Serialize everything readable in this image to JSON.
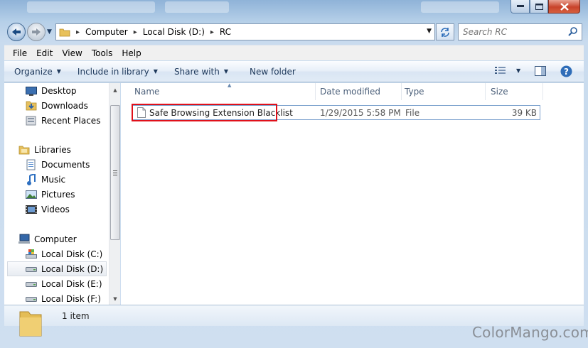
{
  "window": {
    "breadcrumbs": [
      "Computer",
      "Local Disk (D:)",
      "RC"
    ]
  },
  "search": {
    "placeholder": "Search RC"
  },
  "menu": [
    "File",
    "Edit",
    "View",
    "Tools",
    "Help"
  ],
  "commands": {
    "organize": "Organize",
    "include_in_library": "Include in library",
    "share_with": "Share with",
    "new_folder": "New folder"
  },
  "navpane": {
    "favorites": [
      {
        "label": "Desktop",
        "icon": "desktop-icon"
      },
      {
        "label": "Downloads",
        "icon": "downloads-folder-icon"
      },
      {
        "label": "Recent Places",
        "icon": "recent-places-icon"
      }
    ],
    "libraries_label": "Libraries",
    "libraries": [
      {
        "label": "Documents",
        "icon": "documents-icon"
      },
      {
        "label": "Music",
        "icon": "music-icon"
      },
      {
        "label": "Pictures",
        "icon": "pictures-icon"
      },
      {
        "label": "Videos",
        "icon": "videos-icon"
      }
    ],
    "computer_label": "Computer",
    "drives": [
      {
        "label": "Local Disk (C:)",
        "icon": "system-drive-icon",
        "selected": false
      },
      {
        "label": "Local Disk (D:)",
        "icon": "drive-icon",
        "selected": true
      },
      {
        "label": "Local Disk (E:)",
        "icon": "drive-icon",
        "selected": false
      },
      {
        "label": "Local Disk (F:)",
        "icon": "drive-icon",
        "selected": false
      }
    ]
  },
  "columns": {
    "name": "Name",
    "date_modified": "Date modified",
    "type": "Type",
    "size": "Size"
  },
  "files": [
    {
      "name": "Safe Browsing Extension Blacklist",
      "date_modified": "1/29/2015 5:58 PM",
      "type": "File",
      "size": "39 KB",
      "highlighted": true
    }
  ],
  "status": {
    "item_count": "1 item"
  },
  "watermark": "ColorMango.com",
  "colors": {
    "highlight_box": "#e0101a",
    "selection_border": "#7da2ce"
  }
}
